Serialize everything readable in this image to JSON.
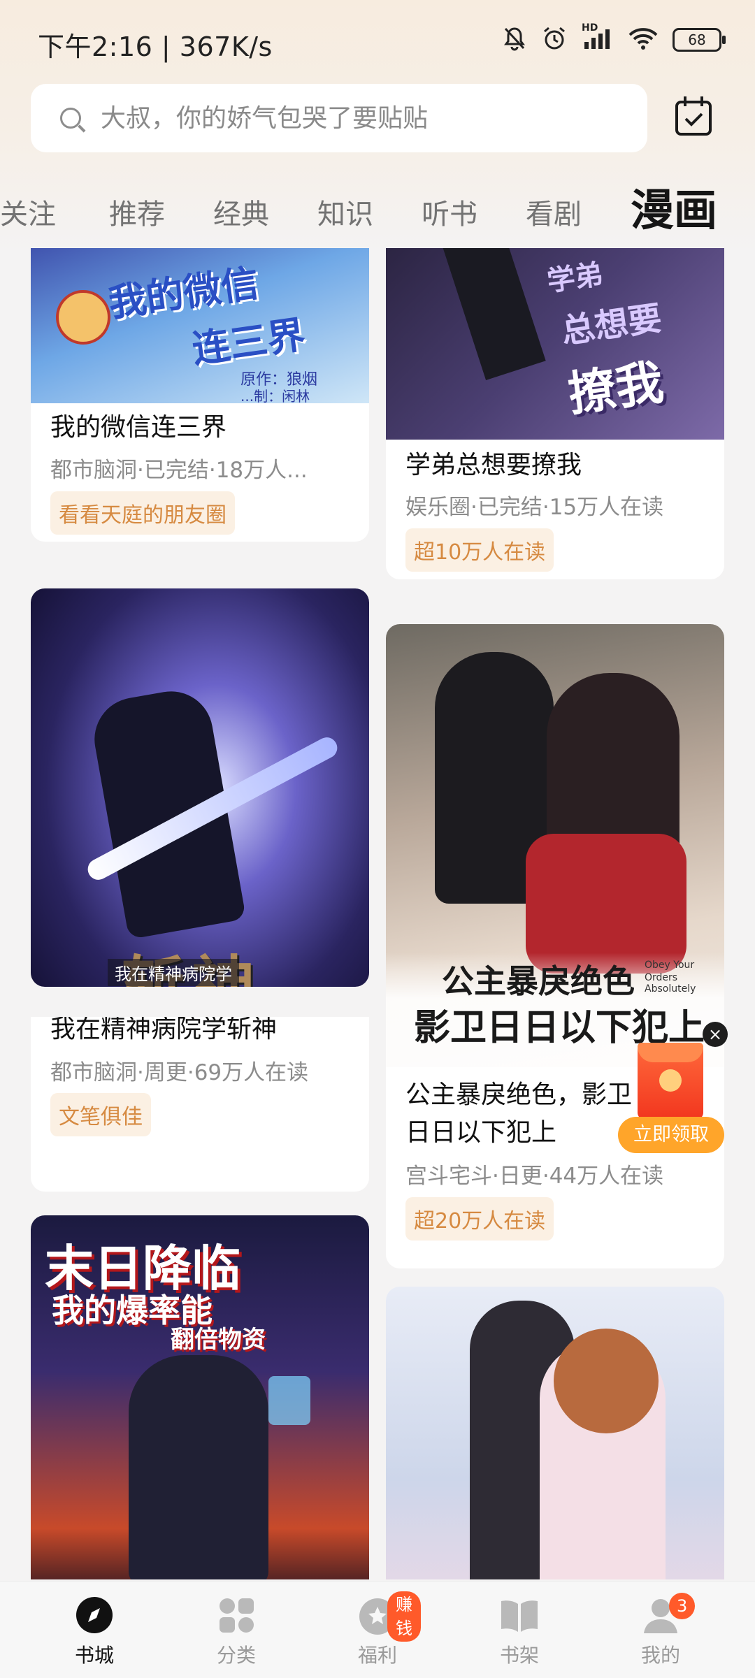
{
  "status_bar": {
    "time_speed": "下午2:16 | 367K/s",
    "battery": "68",
    "net_label": "HD"
  },
  "search": {
    "placeholder": "大叔，你的娇气包哭了要贴贴"
  },
  "tabs": [
    "关注",
    "推荐",
    "经典",
    "知识",
    "听书",
    "看剧",
    "漫画"
  ],
  "active_tab": "漫画",
  "cards": [
    {
      "title": "我的微信连三界",
      "meta": "都市脑洞·已完结·18万人...",
      "tag": "看看天庭的朋友圈",
      "cover_art": [
        "我的微信",
        "连三界"
      ],
      "cover_credit": "原作：狼烟",
      "cover_credit2": "...制：闲林"
    },
    {
      "title": "学弟总想要撩我",
      "meta": "娱乐圈·已完结·15万人在读",
      "tag": "超10万人在读",
      "cover_art": [
        "学弟",
        "总想要",
        "撩我"
      ]
    },
    {
      "title": "我在精神病院学斩神",
      "meta": "都市脑洞·周更·69万人在读",
      "tag": "文笔俱佳",
      "cover_art": [
        "斩神",
        "我在精神病院学"
      ]
    },
    {
      "title": "公主暴戾绝色，影卫日日以下犯上",
      "title_line1": "公主暴戾绝色，影卫",
      "title_line2": "日日以下犯上",
      "meta": "宫斗宅斗·日更·44万人在读",
      "tag": "超20万人在读",
      "cover_art": [
        "公主暴戾绝色",
        "影卫日日以下犯上"
      ],
      "cover_sub": [
        "Obey Your",
        "Orders Absolutely"
      ]
    },
    {
      "cover_art": [
        "末日降临",
        "我的爆率能",
        "翻倍物资"
      ]
    },
    {
      "cover_art": []
    }
  ],
  "floating": {
    "claim_label": "立即领取",
    "close": "×"
  },
  "nav": {
    "items": [
      {
        "label": "书城",
        "icon": "compass-icon"
      },
      {
        "label": "分类",
        "icon": "category-grid-icon"
      },
      {
        "label": "福利",
        "icon": "gift-star-icon"
      },
      {
        "label": "书架",
        "icon": "open-book-icon"
      },
      {
        "label": "我的",
        "icon": "person-icon"
      }
    ],
    "welfare_badge": "赚钱",
    "mine_badge": "3"
  },
  "colors": {
    "accent_orange": "#ffa52a",
    "tag_text": "#d68a41",
    "badge_red": "#ff5a2a"
  }
}
